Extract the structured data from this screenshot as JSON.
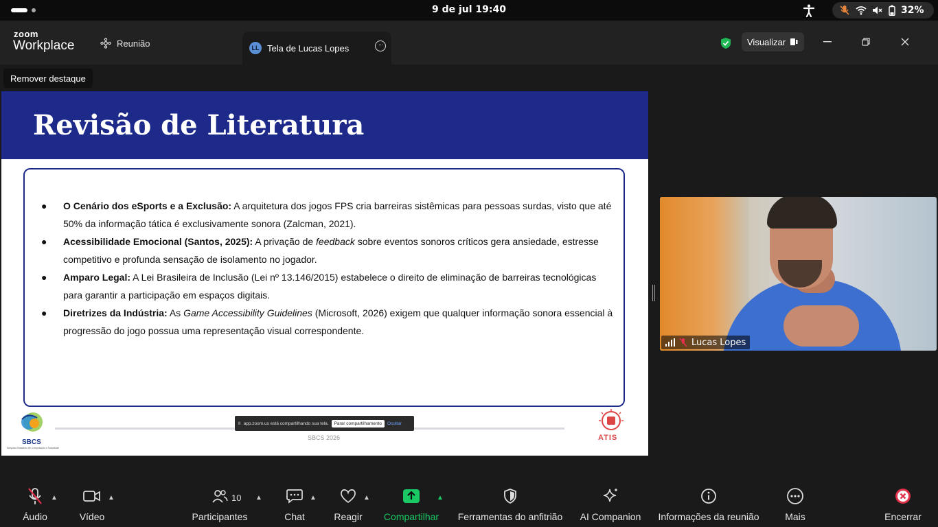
{
  "system": {
    "clock": "9 de jul  19:40",
    "battery": "32%"
  },
  "app": {
    "logo_top": "zoom",
    "logo_bottom": "Workplace",
    "tab_meeting": "Reunião",
    "tab_share_badge": "LL",
    "tab_share": "Tela de Lucas Lopes",
    "view_button": "Visualizar"
  },
  "meeting": {
    "remove_spotlight": "Remover destaque"
  },
  "slide": {
    "title": "Revisão de Literatura",
    "bullets": [
      {
        "bold": "O Cenário dos eSports e a Exclusão:",
        "text": " A arquitetura dos jogos FPS cria barreiras sistêmicas para pessoas surdas, visto que até 50% da informação tática é exclusivamente sonora (Zalcman, 2021)."
      },
      {
        "bold": "Acessibilidade Emocional (Santos, 2025):",
        "text_a": " A privação de ",
        "italic": "feedback",
        "text_b": " sobre eventos sonoros críticos gera ansiedade, estresse competitivo e profunda sensação de isolamento no jogador."
      },
      {
        "bold": "Amparo Legal:",
        "text": " A Lei Brasileira de Inclusão (Lei nº 13.146/2015) estabelece o direito de eliminação de barreiras tecnológicas para garantir a participação em espaços digitais."
      },
      {
        "bold": "Diretrizes da Indústria:",
        "text_a": " As ",
        "italic": "Game Accessibility Guidelines",
        "text_b": " (Microsoft, 2026) exigem que qualquer informação sonora essencial à progressão do jogo possua uma representação visual correspondente."
      }
    ],
    "footer": "SBCS 2026",
    "sbcs_logo_text": "SBCS",
    "sbcs_logo_sub": "Simpósio Brasileiro de Computação e Sociedade",
    "atis_logo_text": "ATIS"
  },
  "share_notice": {
    "pause": "II",
    "text": "app.zoom.us está compartilhando sua tela.",
    "stop": "Parar compartilhamento",
    "hide": "Ocultar"
  },
  "video": {
    "participant_name": "Lucas Lopes"
  },
  "toolbar": {
    "audio": "Áudio",
    "video": "Vídeo",
    "participants": "Participantes",
    "participants_count": "10",
    "chat": "Chat",
    "react": "Reagir",
    "share": "Compartilhar",
    "host_tools": "Ferramentas do anfitrião",
    "ai_companion": "AI Companion",
    "meeting_info": "Informações da reunião",
    "more": "Mais",
    "end": "Encerrar"
  },
  "colors": {
    "slide_header": "#1e2a8a",
    "share_green": "#18c964",
    "end_red": "#e0304a"
  }
}
